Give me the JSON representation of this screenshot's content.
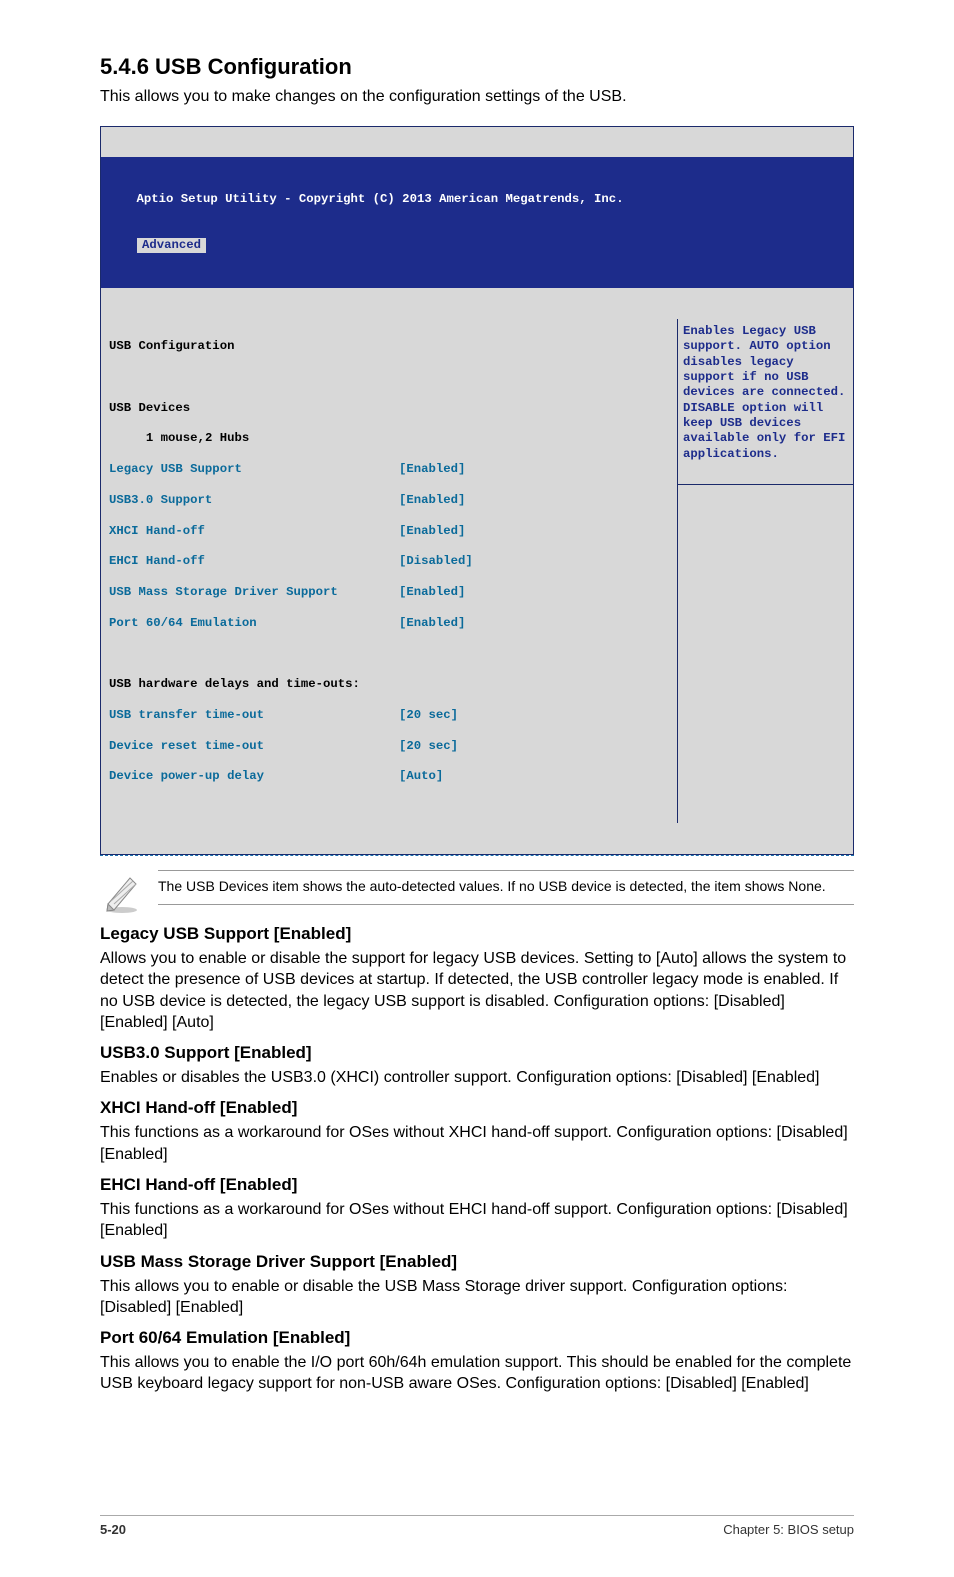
{
  "heading": "5.4.6 USB Configuration",
  "intro": "This allows you to make changes on the configuration settings of the USB.",
  "bios": {
    "title": "Aptio Setup Utility - Copyright (C) 2013 American Megatrends, Inc.",
    "tab": "Advanced",
    "section_title": "USB Configuration",
    "devices_label": "USB Devices",
    "devices_value": "1 mouse,2 Hubs",
    "rows": [
      {
        "label": "Legacy USB Support",
        "value": "[Enabled]"
      },
      {
        "label": "USB3.0 Support",
        "value": "[Enabled]"
      },
      {
        "label": "XHCI Hand-off",
        "value": "[Enabled]"
      },
      {
        "label": "EHCI Hand-off",
        "value": "[Disabled]"
      },
      {
        "label": "USB Mass Storage Driver Support",
        "value": "[Enabled]"
      },
      {
        "label": "Port 60/64 Emulation",
        "value": "[Enabled]"
      }
    ],
    "subheader": "USB hardware delays and time-outs:",
    "rows2": [
      {
        "label": "USB transfer time-out",
        "value": "[20 sec]"
      },
      {
        "label": "Device reset time-out",
        "value": "[20 sec]"
      },
      {
        "label": "Device power-up delay",
        "value": "[Auto]"
      }
    ],
    "help": "Enables Legacy USB support. AUTO option disables legacy support if no USB devices are connected. DISABLE option will keep USB devices available only for EFI applications."
  },
  "note": "The USB Devices item shows the auto-detected values. If no USB device is detected, the item shows None.",
  "sections": [
    {
      "title": "Legacy USB Support [Enabled]",
      "body": "Allows you to enable or disable the support for legacy USB devices. Setting to [Auto] allows the system to detect the presence of USB devices at startup. If detected, the USB controller legacy mode is enabled. If no USB device is detected, the legacy USB support is disabled. Configuration options: [Disabled] [Enabled] [Auto]"
    },
    {
      "title": "USB3.0 Support [Enabled]",
      "body": "Enables or disables the USB3.0 (XHCI) controller support. Configuration options: [Disabled] [Enabled]"
    },
    {
      "title": "XHCI Hand-off [Enabled]",
      "body": "This functions as a workaround for OSes without XHCI hand-off support. Configuration options: [Disabled] [Enabled]"
    },
    {
      "title": "EHCI Hand-off [Enabled]",
      "body": "This functions as a workaround for OSes without EHCI hand-off support. Configuration options: [Disabled] [Enabled]"
    },
    {
      "title": "USB Mass Storage Driver Support [Enabled]",
      "body": "This allows you to enable or disable the USB Mass Storage driver support. Configuration options: [Disabled] [Enabled]"
    },
    {
      "title": "Port 60/64 Emulation [Enabled]",
      "body": "This allows you to enable the I/O port 60h/64h emulation support. This should be enabled for the complete USB keyboard legacy support for non-USB aware OSes. Configuration options: [Disabled] [Enabled]"
    }
  ],
  "footer": {
    "left": "5-20",
    "right": "Chapter 5: BIOS setup"
  }
}
